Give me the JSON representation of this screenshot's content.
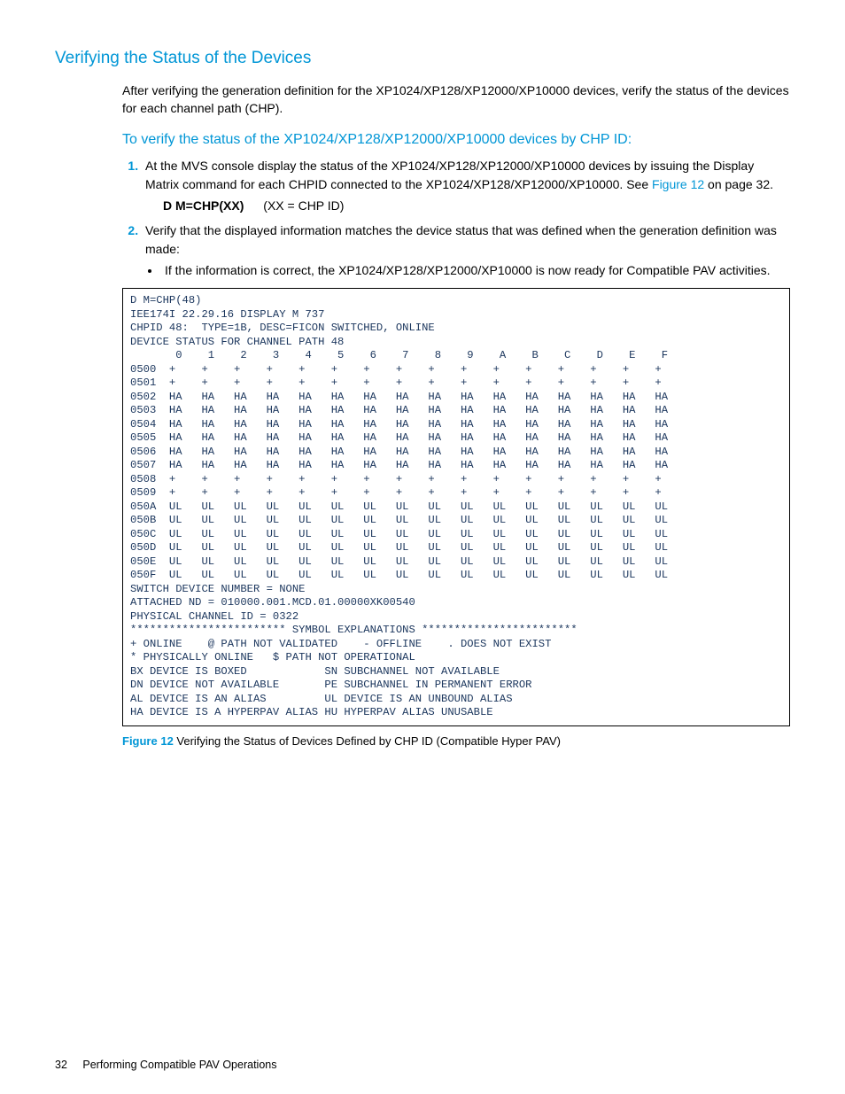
{
  "heading": "Verifying the Status of the Devices",
  "intro": "After verifying the generation definition for the XP1024/XP128/XP12000/XP10000 devices, verify the status of the devices for each channel path (CHP).",
  "subheading": "To verify the status of the XP1024/XP128/XP12000/XP10000 devices by CHP ID:",
  "step1": {
    "text_a": "At the MVS console display the status of the XP1024/XP128/XP12000/XP10000 devices by issuing the Display Matrix command for each CHPID connected to the XP1024/XP128/XP12000/XP10000. See ",
    "figure_ref": "Figure 12",
    "text_b": " on page 32.",
    "cmd": "D M=CHP(XX)",
    "cmd_note": "(XX = CHP ID)"
  },
  "step2": {
    "text": "Verify that the displayed information matches the device status that was defined when the generation definition was made:",
    "bullet": "If the information is correct, the XP1024/XP128/XP12000/XP10000 is now ready for Compatible PAV activities."
  },
  "terminal": "D M=CHP(48)\nIEE174I 22.29.16 DISPLAY M 737\nCHPID 48:  TYPE=1B, DESC=FICON SWITCHED, ONLINE\nDEVICE STATUS FOR CHANNEL PATH 48\n       0    1    2    3    4    5    6    7    8    9    A    B    C    D    E    F\n0500  +    +    +    +    +    +    +    +    +    +    +    +    +    +    +    +\n0501  +    +    +    +    +    +    +    +    +    +    +    +    +    +    +    +\n0502  HA   HA   HA   HA   HA   HA   HA   HA   HA   HA   HA   HA   HA   HA   HA   HA\n0503  HA   HA   HA   HA   HA   HA   HA   HA   HA   HA   HA   HA   HA   HA   HA   HA\n0504  HA   HA   HA   HA   HA   HA   HA   HA   HA   HA   HA   HA   HA   HA   HA   HA\n0505  HA   HA   HA   HA   HA   HA   HA   HA   HA   HA   HA   HA   HA   HA   HA   HA\n0506  HA   HA   HA   HA   HA   HA   HA   HA   HA   HA   HA   HA   HA   HA   HA   HA\n0507  HA   HA   HA   HA   HA   HA   HA   HA   HA   HA   HA   HA   HA   HA   HA   HA\n0508  +    +    +    +    +    +    +    +    +    +    +    +    +    +    +    +\n0509  +    +    +    +    +    +    +    +    +    +    +    +    +    +    +    +\n050A  UL   UL   UL   UL   UL   UL   UL   UL   UL   UL   UL   UL   UL   UL   UL   UL\n050B  UL   UL   UL   UL   UL   UL   UL   UL   UL   UL   UL   UL   UL   UL   UL   UL\n050C  UL   UL   UL   UL   UL   UL   UL   UL   UL   UL   UL   UL   UL   UL   UL   UL\n050D  UL   UL   UL   UL   UL   UL   UL   UL   UL   UL   UL   UL   UL   UL   UL   UL\n050E  UL   UL   UL   UL   UL   UL   UL   UL   UL   UL   UL   UL   UL   UL   UL   UL\n050F  UL   UL   UL   UL   UL   UL   UL   UL   UL   UL   UL   UL   UL   UL   UL   UL\nSWITCH DEVICE NUMBER = NONE\nATTACHED ND = 010000.001.MCD.01.00000XK00540\nPHYSICAL CHANNEL ID = 0322\n************************ SYMBOL EXPLANATIONS ************************\n+ ONLINE    @ PATH NOT VALIDATED    - OFFLINE    . DOES NOT EXIST\n* PHYSICALLY ONLINE   $ PATH NOT OPERATIONAL\nBX DEVICE IS BOXED            SN SUBCHANNEL NOT AVAILABLE\nDN DEVICE NOT AVAILABLE       PE SUBCHANNEL IN PERMANENT ERROR\nAL DEVICE IS AN ALIAS         UL DEVICE IS AN UNBOUND ALIAS\nHA DEVICE IS A HYPERPAV ALIAS HU HYPERPAV ALIAS UNUSABLE",
  "figure": {
    "label": "Figure 12",
    "caption": "Verifying the Status of Devices Defined by CHP ID (Compatible Hyper PAV)"
  },
  "footer": {
    "page": "32",
    "section": "Performing Compatible PAV Operations"
  }
}
